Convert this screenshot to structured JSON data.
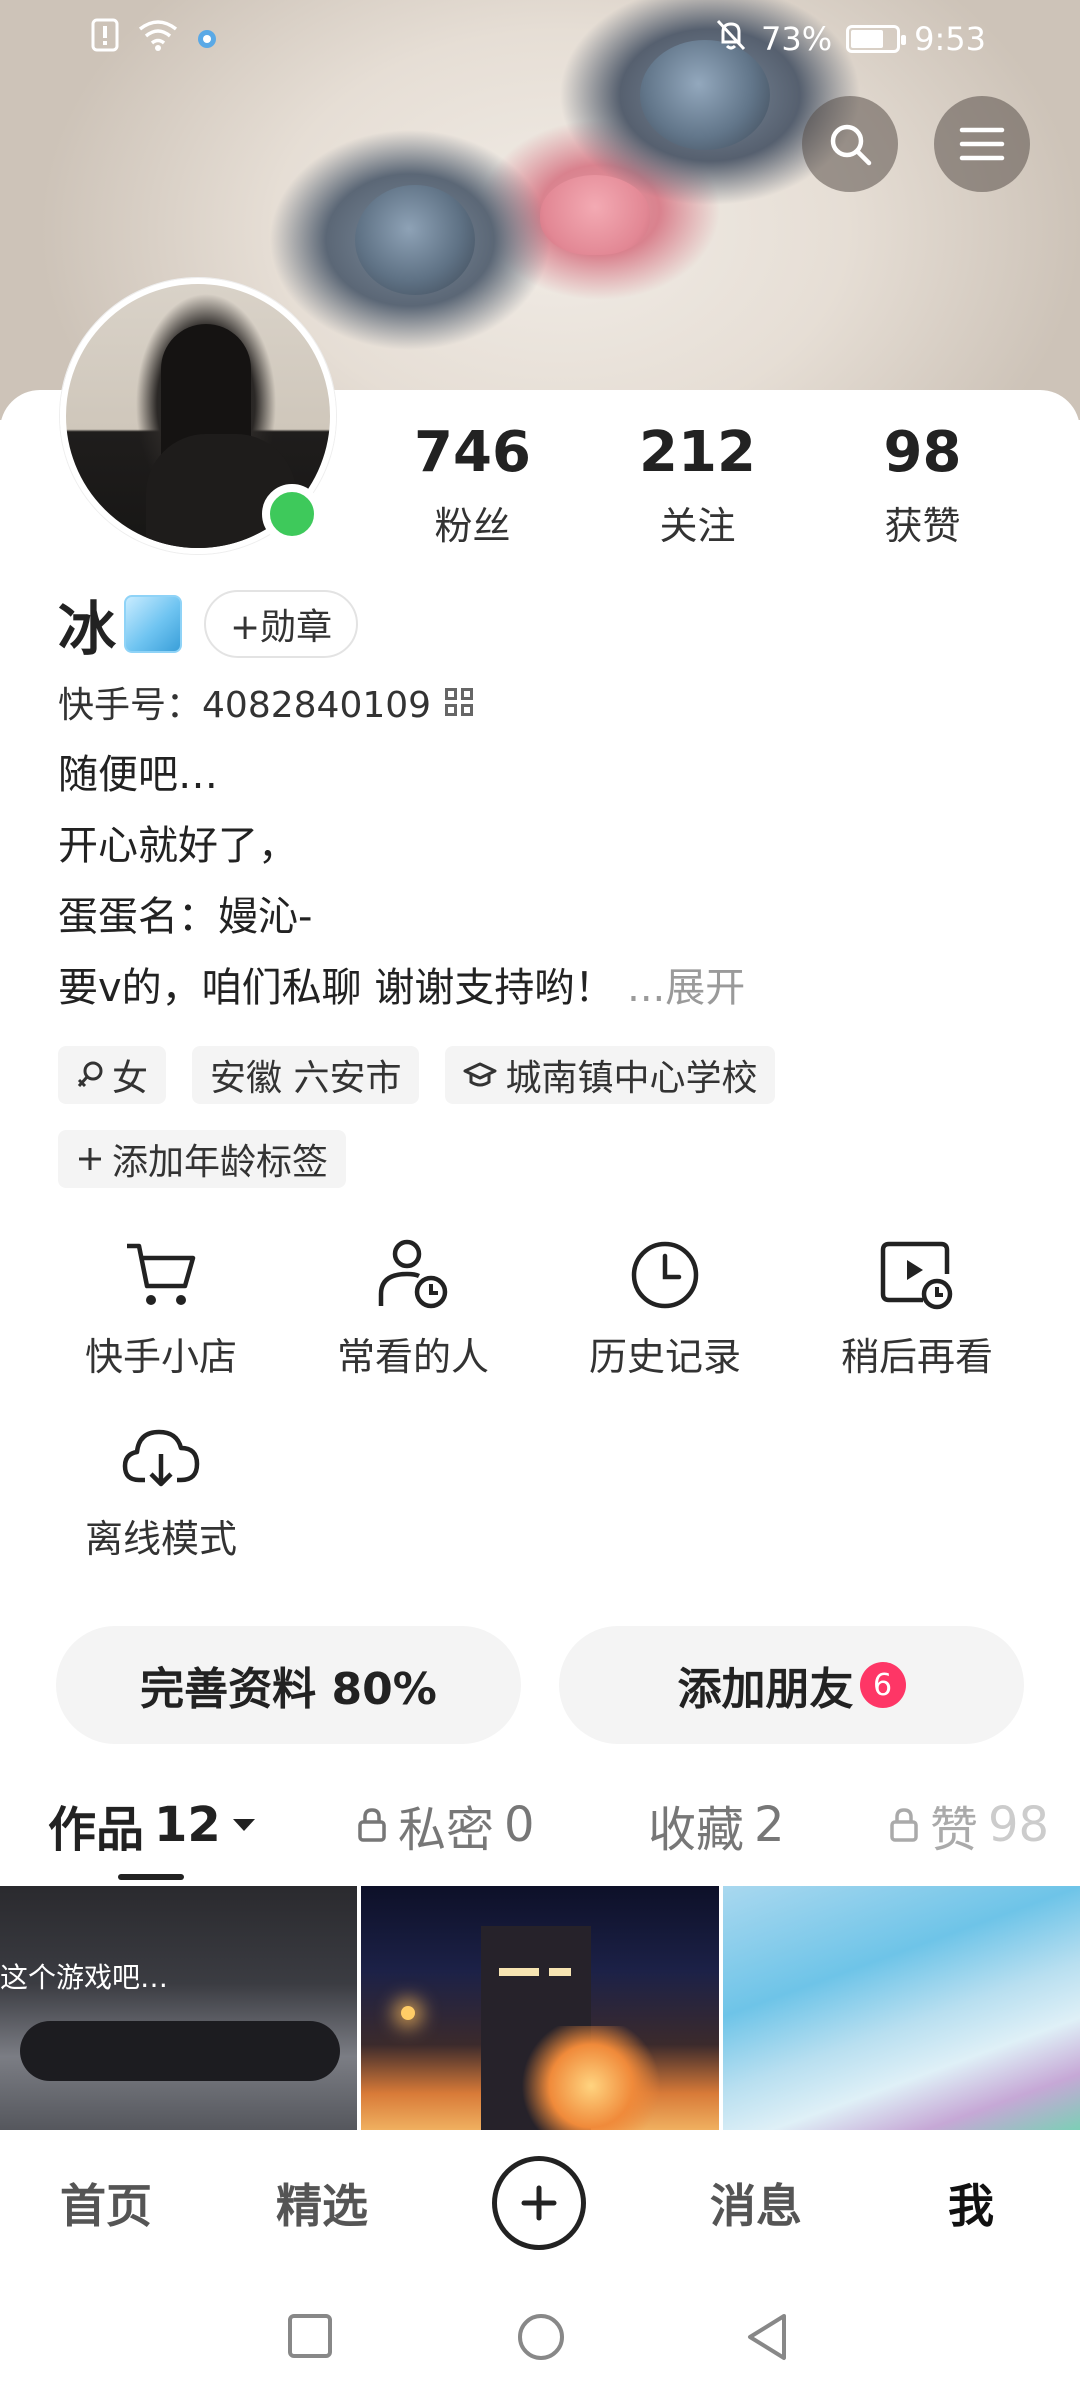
{
  "status_bar": {
    "battery": "73%",
    "battery_level": 0.73,
    "time": "9:53"
  },
  "profile": {
    "stats": [
      {
        "num": "746",
        "label": "粉丝"
      },
      {
        "num": "212",
        "label": "关注"
      },
      {
        "num": "98",
        "label": "获赞"
      }
    ],
    "name": "冰",
    "badge_button": "+勋章",
    "id_label": "快手号：",
    "id_value": "4082840109",
    "bio_lines": [
      "随便吧…",
      "开心就好了，",
      "蛋蛋名：嫚沁-",
      "要v的，咱们私聊 谢谢支持哟！"
    ],
    "expand": "...展开",
    "tags": [
      "女",
      "安徽 六安市",
      "城南镇中心学校"
    ],
    "add_age_tag": "添加年龄标签"
  },
  "features": [
    {
      "label": "快手小店",
      "icon": "cart-icon"
    },
    {
      "label": "常看的人",
      "icon": "person-clock-icon"
    },
    {
      "label": "历史记录",
      "icon": "clock-icon"
    },
    {
      "label": "稍后再看",
      "icon": "video-clock-icon"
    },
    {
      "label": "离线模式",
      "icon": "cloud-download-icon"
    }
  ],
  "actions": {
    "complete_profile": "完善资料 80%",
    "add_friends": "添加朋友",
    "add_friends_count": "6"
  },
  "tabs": [
    {
      "label": "作品",
      "count": "12"
    },
    {
      "label": "私密",
      "count": "0"
    },
    {
      "label": "收藏",
      "count": "2"
    },
    {
      "label": "赞",
      "count": "98"
    }
  ],
  "grid": {
    "item1_caption": "这个游戏吧…"
  },
  "bottom_nav": [
    "首页",
    "精选",
    "消息",
    "我"
  ],
  "colors": {
    "online": "#3ec95b",
    "notify": "#fe3666"
  }
}
